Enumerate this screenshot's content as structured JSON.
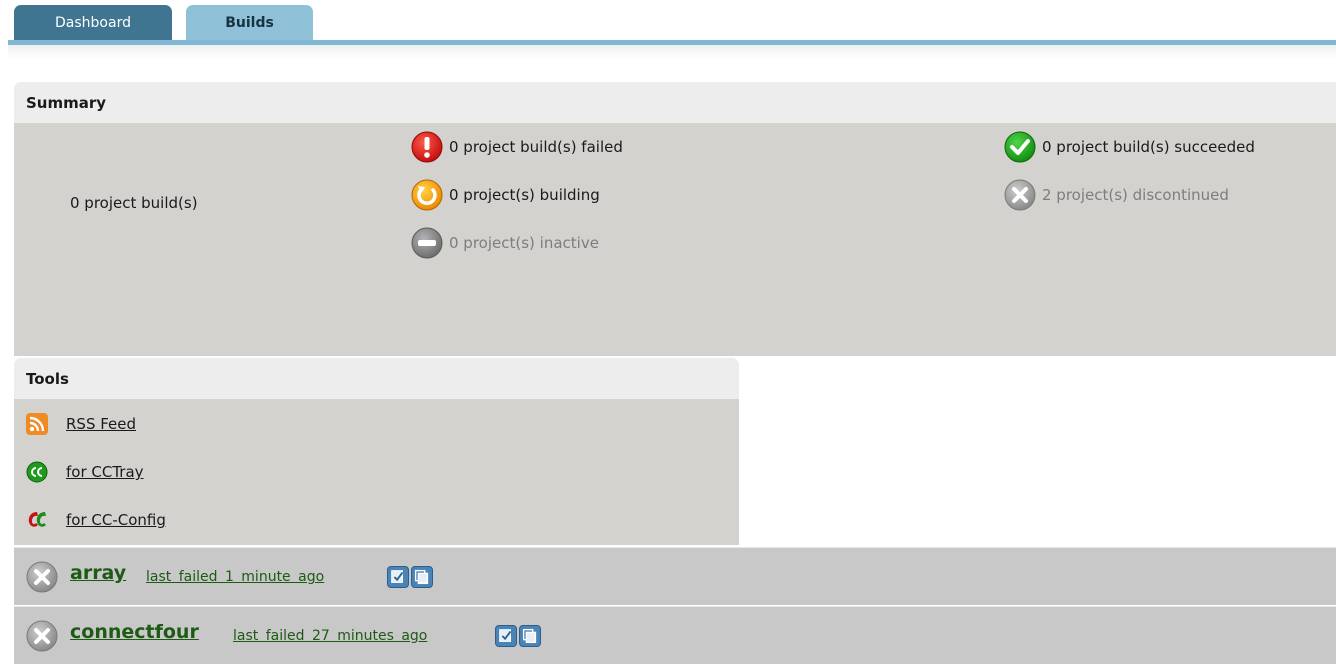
{
  "tabs": [
    {
      "label": "Dashboard",
      "active": false
    },
    {
      "label": "Builds",
      "active": true
    }
  ],
  "summary": {
    "title": "Summary",
    "total": "0 project build(s)",
    "failed": "0 project build(s) failed",
    "building": "0 project(s) building",
    "inactive": "0 project(s) inactive",
    "succeeded": "0 project build(s) succeeded",
    "discontinued": "2 project(s) discontinued"
  },
  "tools": {
    "title": "Tools",
    "items": [
      {
        "label": "RSS Feed",
        "icon": "rss-icon"
      },
      {
        "label": "for CCTray",
        "icon": "cctray-icon"
      },
      {
        "label": "for CC-Config",
        "icon": "ccconfig-icon"
      }
    ]
  },
  "projects": [
    {
      "name": "array",
      "detail": "last failed 1 minute ago",
      "status": "discontinued"
    },
    {
      "name": "connectfour",
      "detail": "last failed 27 minutes ago",
      "status": "discontinued"
    }
  ],
  "colors": {
    "tab_active": "#8ec0d8",
    "tab_inactive": "#3f7591",
    "panel_body": "#d4d2ce",
    "project_row": "#c8c8c8",
    "link_green": "#1d5a14"
  }
}
